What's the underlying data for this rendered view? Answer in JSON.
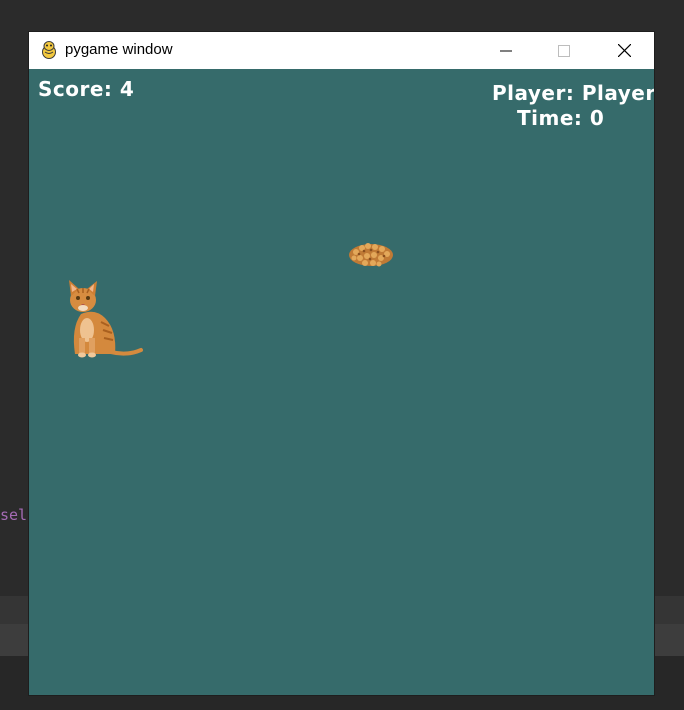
{
  "window": {
    "title": "pygame window"
  },
  "hud": {
    "score": "Score: 4",
    "player": "Player: Player",
    "time": "Time: 0"
  },
  "background": {
    "code_fragment": "sel"
  },
  "colors": {
    "canvas": "#366b6b",
    "hud_text": "#ffffff"
  }
}
